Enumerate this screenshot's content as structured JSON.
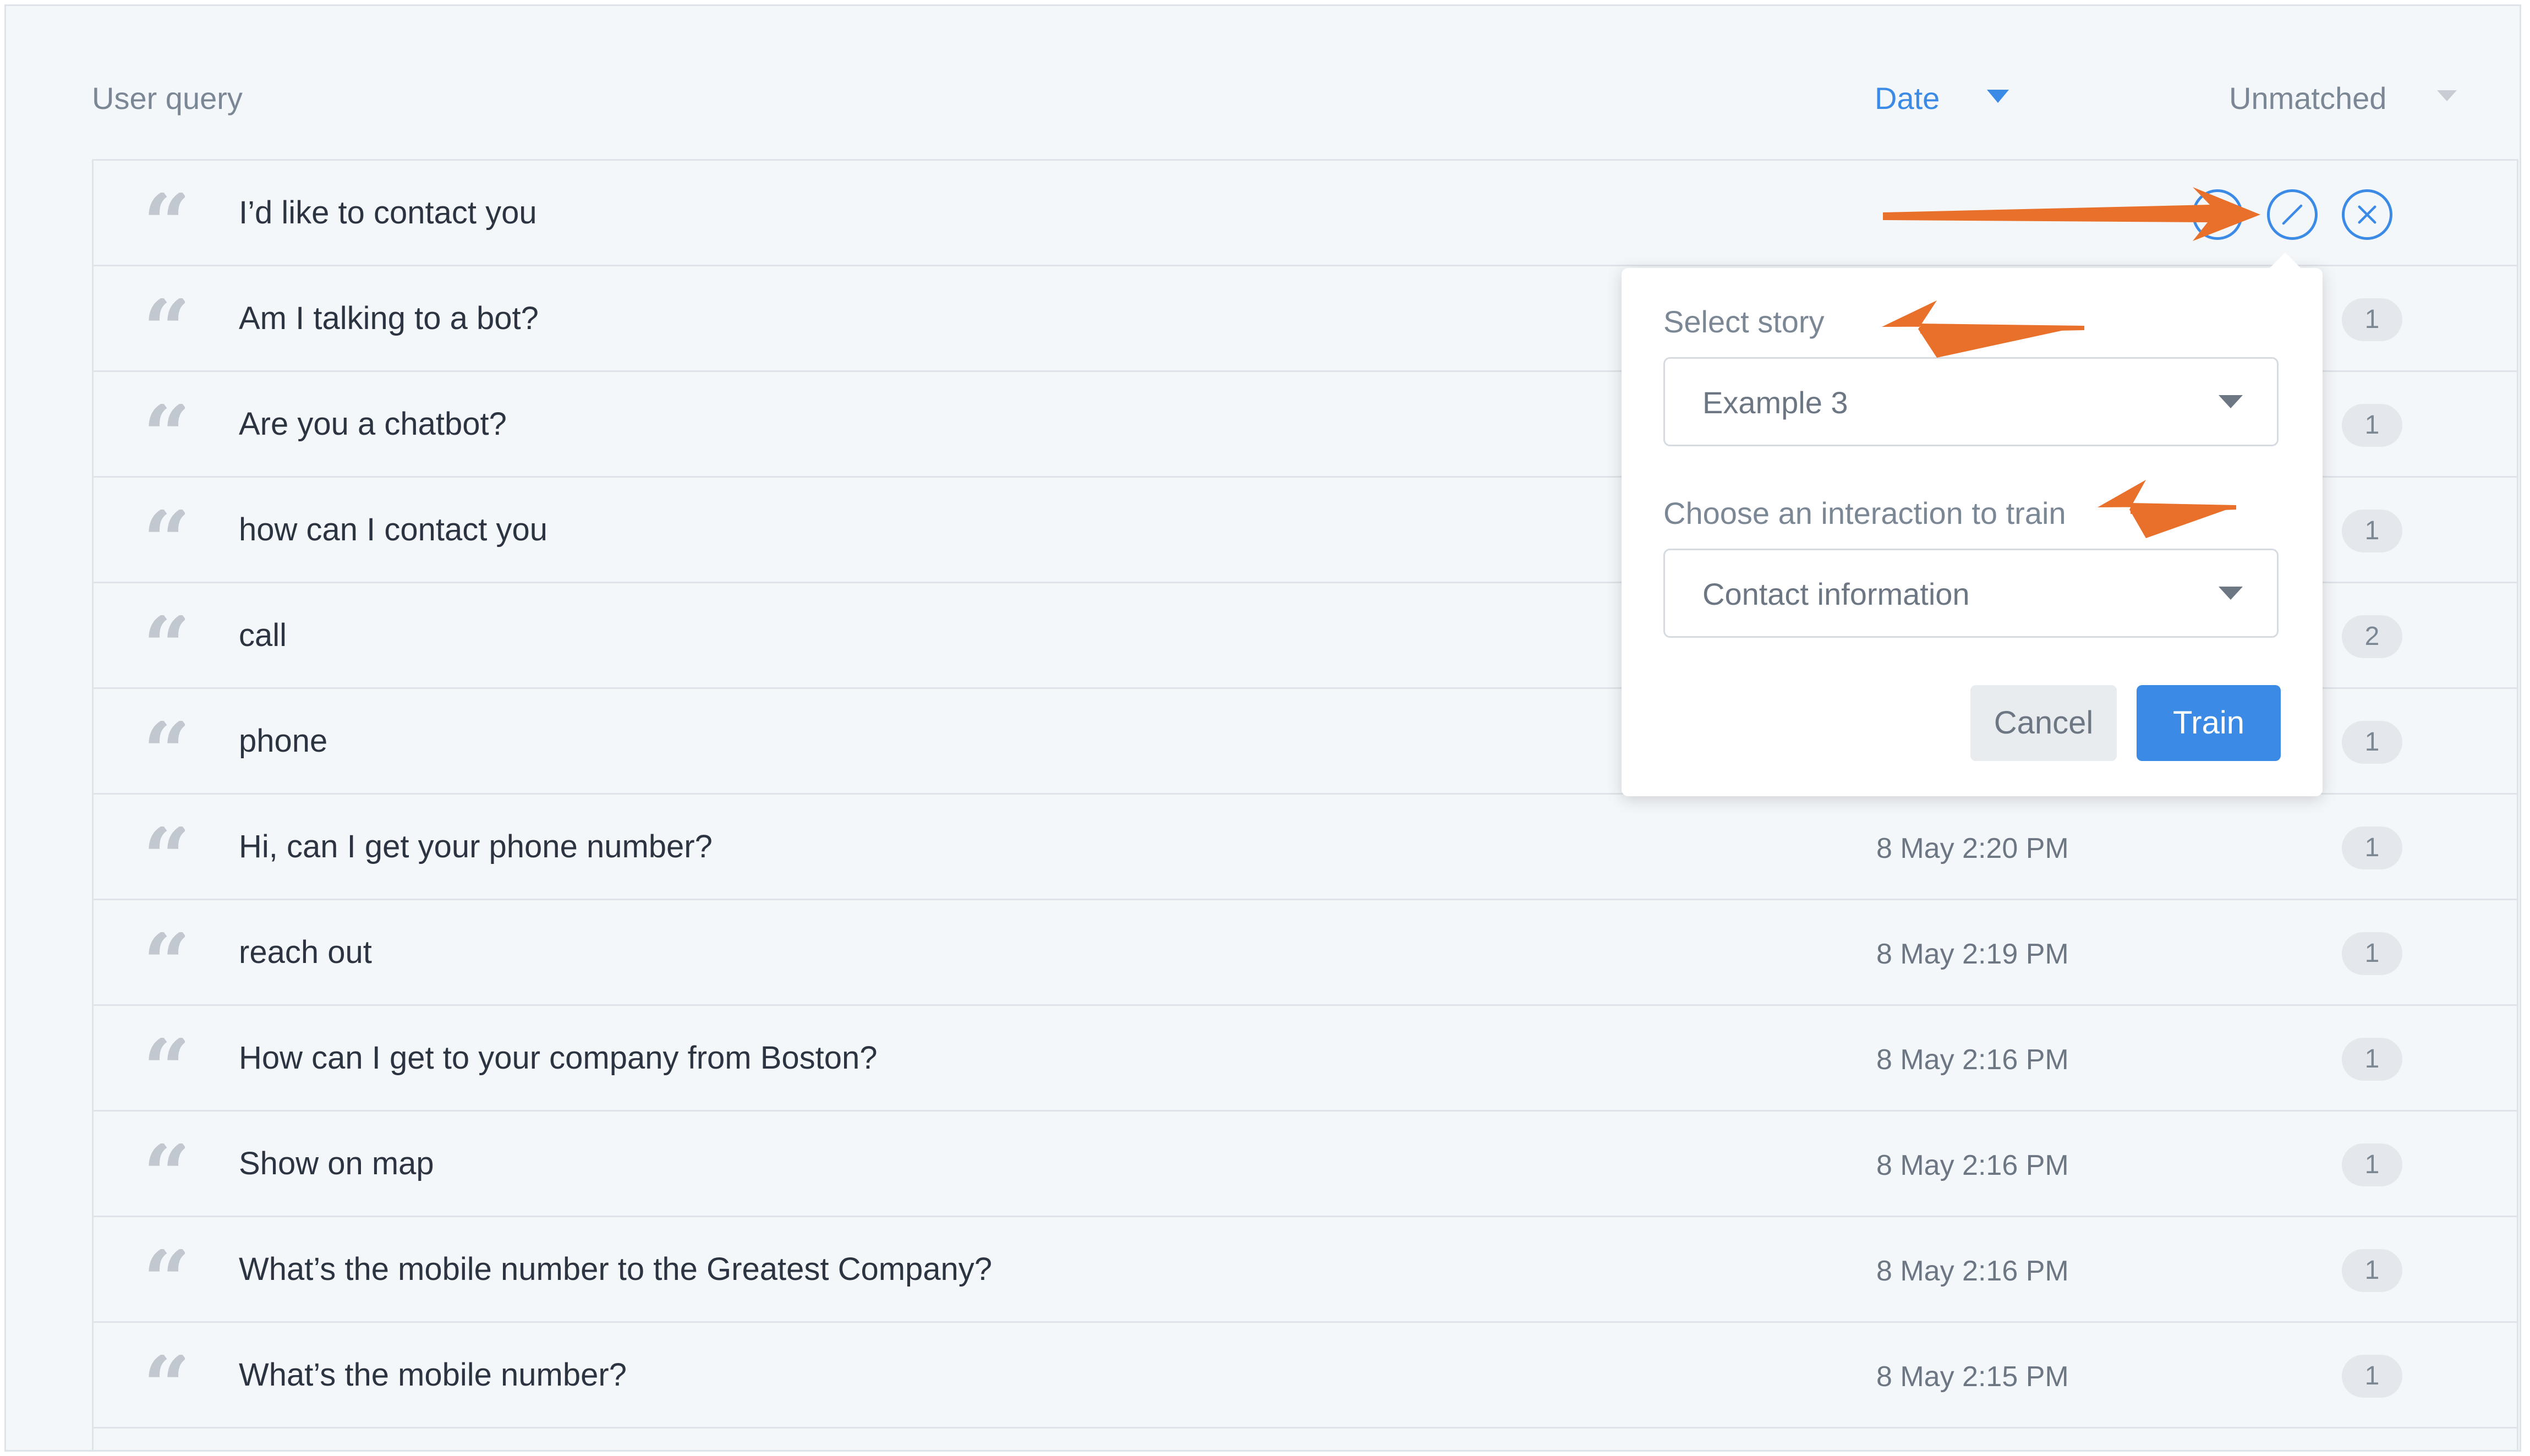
{
  "header": {
    "user_query_label": "User query",
    "date_label": "Date",
    "unmatched_label": "Unmatched"
  },
  "rows": [
    {
      "query": "I’d like to contact you",
      "date": "",
      "count": ""
    },
    {
      "query": "Am I talking to a bot?",
      "date": "",
      "count": "1"
    },
    {
      "query": "Are you a chatbot?",
      "date": "",
      "count": "1"
    },
    {
      "query": "how can I contact you",
      "date": "",
      "count": "1"
    },
    {
      "query": "call",
      "date": "",
      "count": "2"
    },
    {
      "query": "phone",
      "date": "",
      "count": "1"
    },
    {
      "query": "Hi, can I get your phone number?",
      "date": "8 May 2:20 PM",
      "count": "1"
    },
    {
      "query": "reach out",
      "date": "8 May 2:19 PM",
      "count": "1"
    },
    {
      "query": "How can I get to your company from Boston?",
      "date": "8 May 2:16 PM",
      "count": "1"
    },
    {
      "query": "Show on map",
      "date": "8 May 2:16 PM",
      "count": "1"
    },
    {
      "query": "What’s the mobile number to the Greatest Company?",
      "date": "8 May 2:16 PM",
      "count": "1"
    },
    {
      "query": "What’s the mobile number?",
      "date": "8 May 2:15 PM",
      "count": "1"
    }
  ],
  "row_actions": {
    "accept_icon": "check-circle-icon",
    "edit_icon": "slash-circle-icon",
    "reject_icon": "x-circle-icon"
  },
  "popover": {
    "story_label": "Select story",
    "story_value": "Example 3",
    "interaction_label": "Choose an interaction to train",
    "interaction_value": "Contact information",
    "cancel_label": "Cancel",
    "train_label": "Train"
  },
  "colors": {
    "accent": "#3b8be6",
    "annotation_arrow": "#e8702a",
    "background": "#f4f7fa"
  }
}
